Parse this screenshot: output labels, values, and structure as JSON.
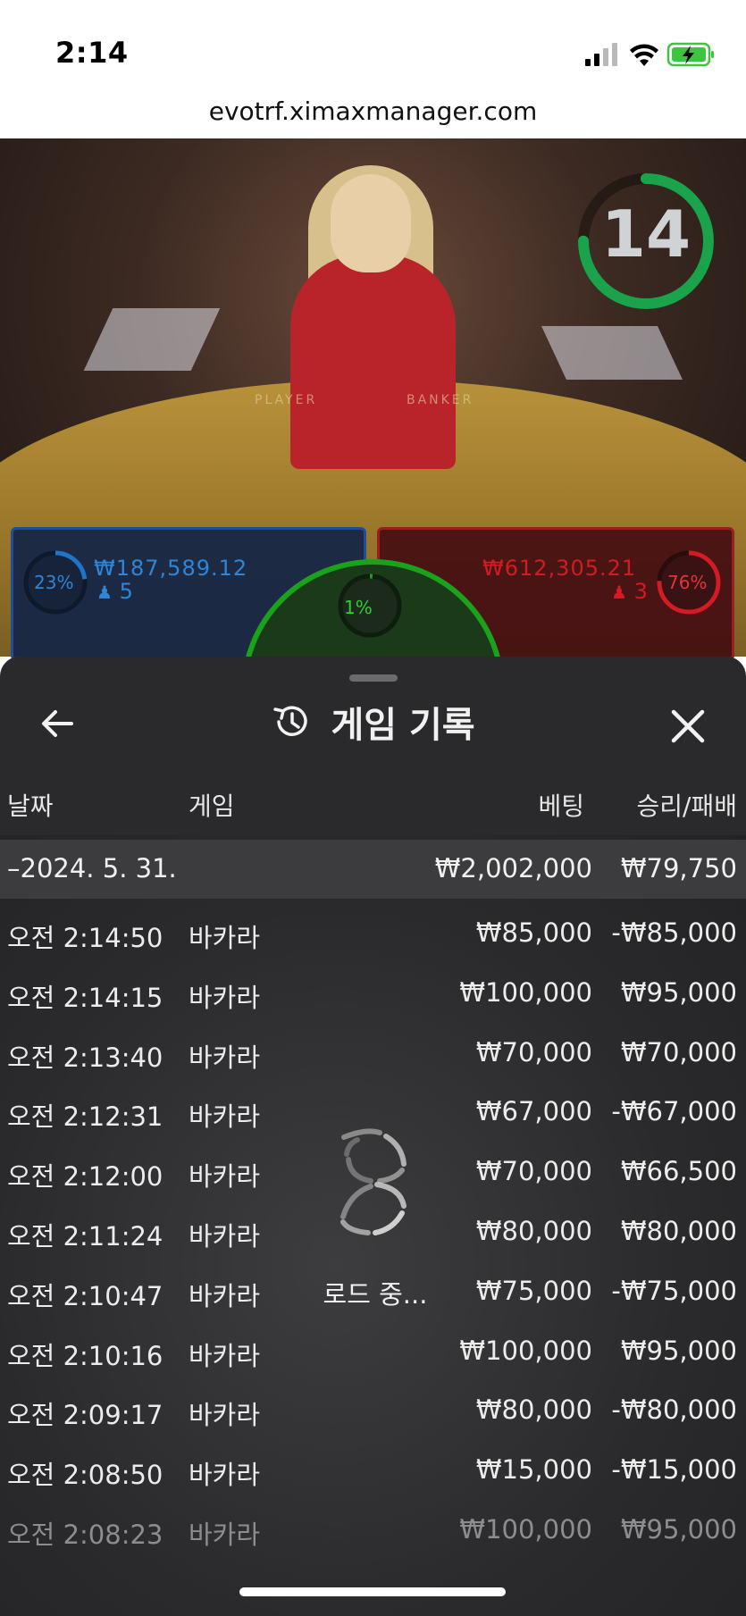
{
  "status": {
    "time": "2:14"
  },
  "browser": {
    "url": "evotrf.ximaxmanager.com"
  },
  "video": {
    "timer": "14",
    "felt_player": "PLAYER",
    "felt_banker": "BANKER"
  },
  "bets": {
    "player": {
      "percent": "23%",
      "amount": "₩187,589.12",
      "players": "5"
    },
    "tie": {
      "percent": "1%"
    },
    "banker": {
      "percent": "76%",
      "amount": "₩612,305.21",
      "players": "3"
    },
    "colors": {
      "player": "#1e74c8",
      "banker": "#d21b22",
      "tie": "#1aa31a"
    }
  },
  "sheet": {
    "title": "게임 기록",
    "icons": {
      "back": "arrow-left-icon",
      "title": "history-icon",
      "close": "close-icon"
    },
    "columns": {
      "date": "날짜",
      "game": "게임",
      "bet": "베팅",
      "winloss": "승리/패배"
    },
    "date_group": {
      "date": "–2024. 5. 31.",
      "bet": "₩2,002,000",
      "winloss": "₩79,750"
    },
    "rows": [
      {
        "time": "오전 2:14:50",
        "game": "바카라",
        "bet": "₩85,000",
        "winloss": "-₩85,000"
      },
      {
        "time": "오전 2:14:15",
        "game": "바카라",
        "bet": "₩100,000",
        "winloss": "₩95,000"
      },
      {
        "time": "오전 2:13:40",
        "game": "바카라",
        "bet": "₩70,000",
        "winloss": "₩70,000"
      },
      {
        "time": "오전 2:12:31",
        "game": "바카라",
        "bet": "₩67,000",
        "winloss": "-₩67,000"
      },
      {
        "time": "오전 2:12:00",
        "game": "바카라",
        "bet": "₩70,000",
        "winloss": "₩66,500"
      },
      {
        "time": "오전 2:11:24",
        "game": "바카라",
        "bet": "₩80,000",
        "winloss": "₩80,000"
      },
      {
        "time": "오전 2:10:47",
        "game": "바카라",
        "bet": "₩75,000",
        "winloss": "-₩75,000"
      },
      {
        "time": "오전 2:10:16",
        "game": "바카라",
        "bet": "₩100,000",
        "winloss": "₩95,000"
      },
      {
        "time": "오전 2:09:17",
        "game": "바카라",
        "bet": "₩80,000",
        "winloss": "-₩80,000"
      },
      {
        "time": "오전 2:08:50",
        "game": "바카라",
        "bet": "₩15,000",
        "winloss": "-₩15,000"
      },
      {
        "time": "오전 2:08:23",
        "game": "바카라",
        "bet": "₩100,000",
        "winloss": "₩95,000"
      }
    ],
    "loading_text": "로드 중..."
  }
}
